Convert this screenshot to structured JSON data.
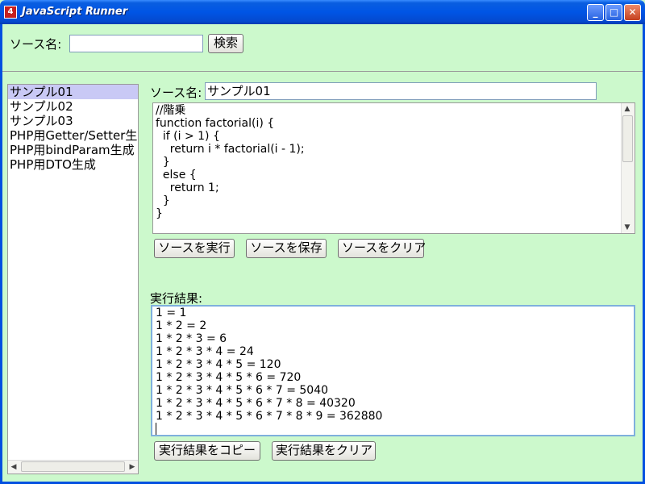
{
  "window": {
    "title": "JavaScript Runner",
    "icon": "app-icon",
    "controls": {
      "minimize": "_",
      "maximize": "□",
      "close": "✕"
    }
  },
  "search": {
    "label": "ソース名:",
    "value": "",
    "button_label": "検索"
  },
  "source_list": {
    "items": [
      "サンプル01",
      "サンプル02",
      "サンプル03",
      "PHP用Getter/Setter生成",
      "PHP用bindParam生成",
      "PHP用DTO生成"
    ],
    "selected_index": 0
  },
  "editor": {
    "name_label": "ソース名:",
    "name_value": "サンプル01",
    "code": "//階乗\nfunction factorial(i) {\n  if (i > 1) {\n    return i * factorial(i - 1);\n  }\n  else {\n    return 1;\n  }\n}"
  },
  "source_buttons": {
    "run": "ソースを実行",
    "save": "ソースを保存",
    "clear": "ソースをクリア"
  },
  "result": {
    "label": "実行結果:",
    "lines": [
      "1 = 1",
      "1 * 2 = 2",
      "1 * 2 * 3 = 6",
      "1 * 2 * 3 * 4 = 24",
      "1 * 2 * 3 * 4 * 5 = 120",
      "1 * 2 * 3 * 4 * 5 * 6 = 720",
      "1 * 2 * 3 * 4 * 5 * 6 * 7 = 5040",
      "1 * 2 * 3 * 4 * 5 * 6 * 7 * 8 = 40320",
      "1 * 2 * 3 * 4 * 5 * 6 * 7 * 8 * 9 = 362880"
    ],
    "copy_button": "実行結果をコピー",
    "clear_button": "実行結果をクリア"
  },
  "colors": {
    "background": "#ccf9cc",
    "titlebar": "#0055e5",
    "selection": "#c9c9f5",
    "result_border": "#7fb0dd"
  }
}
